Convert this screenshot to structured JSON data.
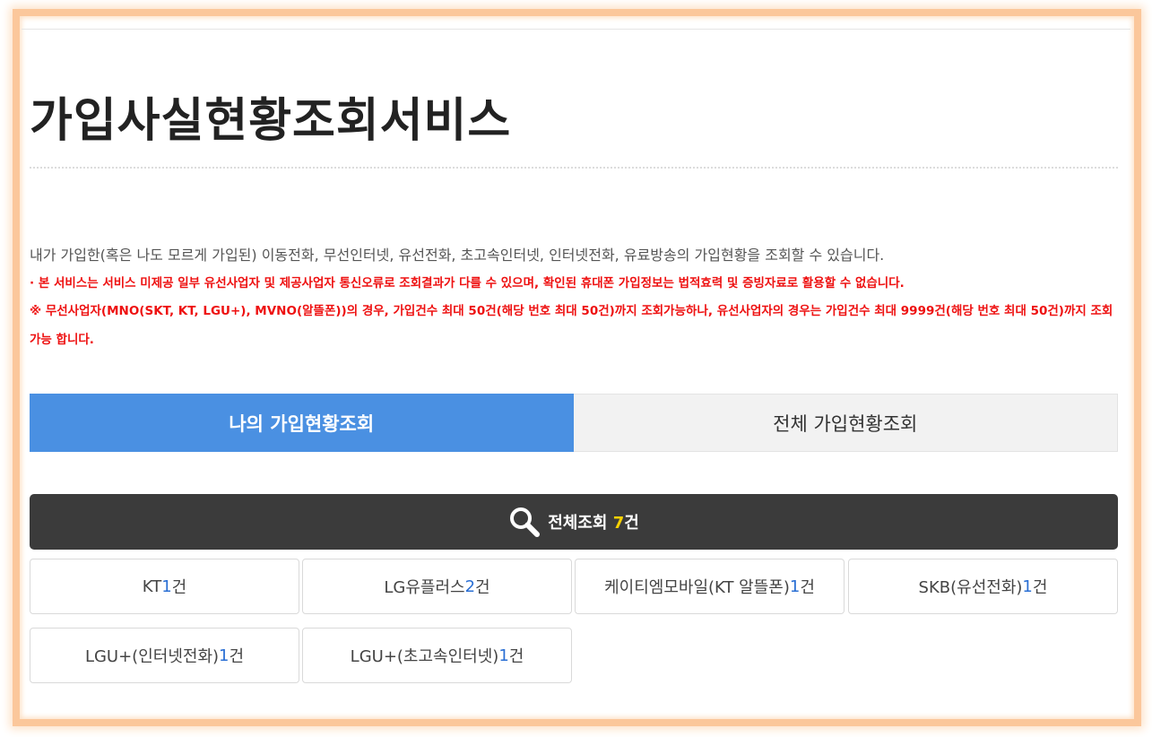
{
  "page": {
    "title": "가입사실현황조회서비스",
    "description": "내가 가입한(혹은 나도 모르게 가입된) 이동전화, 무선인터넷, 유선전화, 초고속인터넷, 인터넷전화, 유료방송의 가입현황을 조회할 수 있습니다.",
    "notice_1": "· 본 서비스는 서비스 미제공 일부 유선사업자 및 제공사업자 통신오류로 조회결과가 다를 수 있으며, 확인된 휴대폰 가입정보는 법적효력 및 증빙자료로 활용할 수 없습니다.",
    "notice_2": "※ 무선사업자(MNO(SKT, KT, LGU+), MVNO(알뜰폰))의 경우, 가입건수 최대 50건(해당 번호 최대 50건)까지 조회가능하나, 유선사업자의 경우는 가입건수 최대 9999건(해당 번호 최대 50건)까지 조회가능 합니다."
  },
  "tabs": [
    {
      "label": "나의 가입현황조회",
      "active": true
    },
    {
      "label": "전체 가입현황조회",
      "active": false
    }
  ],
  "total": {
    "label": "전체조회 ",
    "count": "7",
    "unit": "건",
    "icon": "search-icon"
  },
  "carriers": [
    {
      "name": "KT",
      "count": "1",
      "unit": "건"
    },
    {
      "name": "LG유플러스",
      "count": "2",
      "unit": "건"
    },
    {
      "name": "케이티엠모바일(KT 알뜰폰)",
      "count": "1",
      "unit": "건"
    },
    {
      "name": "SKB(유선전화)",
      "count": "1",
      "unit": "건"
    },
    {
      "name": "LGU+(인터넷전화)",
      "count": "1",
      "unit": "건"
    },
    {
      "name": "LGU+(초고속인터넷)",
      "count": "1",
      "unit": "건"
    }
  ],
  "colors": {
    "active_tab": "#4a90e2",
    "total_bar": "#3b3b3b",
    "notice": "#ee1111",
    "count_highlight": "#f7d100",
    "count_blue": "#2a6fd4",
    "frame": "#fbc79b"
  }
}
